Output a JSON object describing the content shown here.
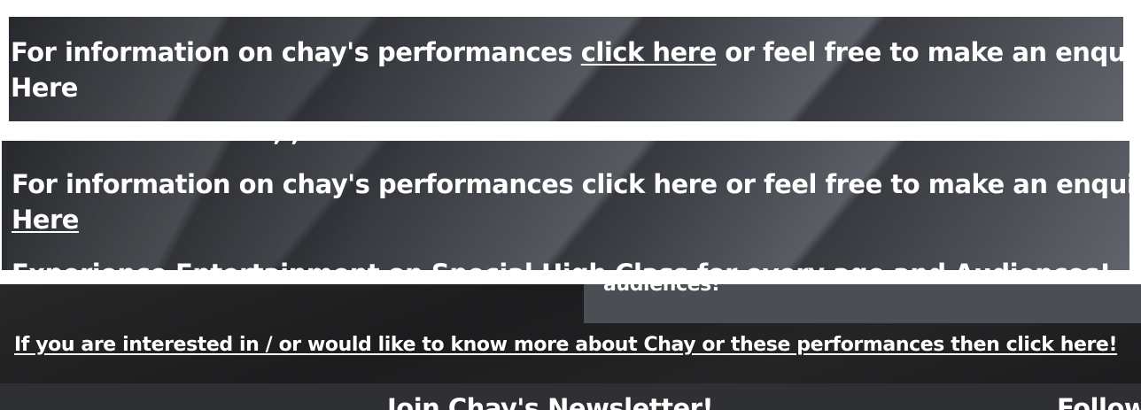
{
  "section1": {
    "text_before": "For information on chay's performances ",
    "link_text": "click here",
    "text_after": " or feel free to make an enquiry",
    "enquiry_link": "Here"
  },
  "section2": {
    "cut_top_text": ", ,",
    "line1": "For information on chay's performances click here or feel free to make an enquiry",
    "enquiry_link": "Here",
    "cut_bottom_text": "Experience Entertainment on Special High Class for every age and Audiences!"
  },
  "section3": {
    "panel_text": "audiences!",
    "interest_link": "If you are interested in / or would like to know more about Chay or these performances then click here!"
  },
  "footer": {
    "newsletter_heading": "Join Chay's Newsletter!",
    "follow_heading": "Follow"
  }
}
